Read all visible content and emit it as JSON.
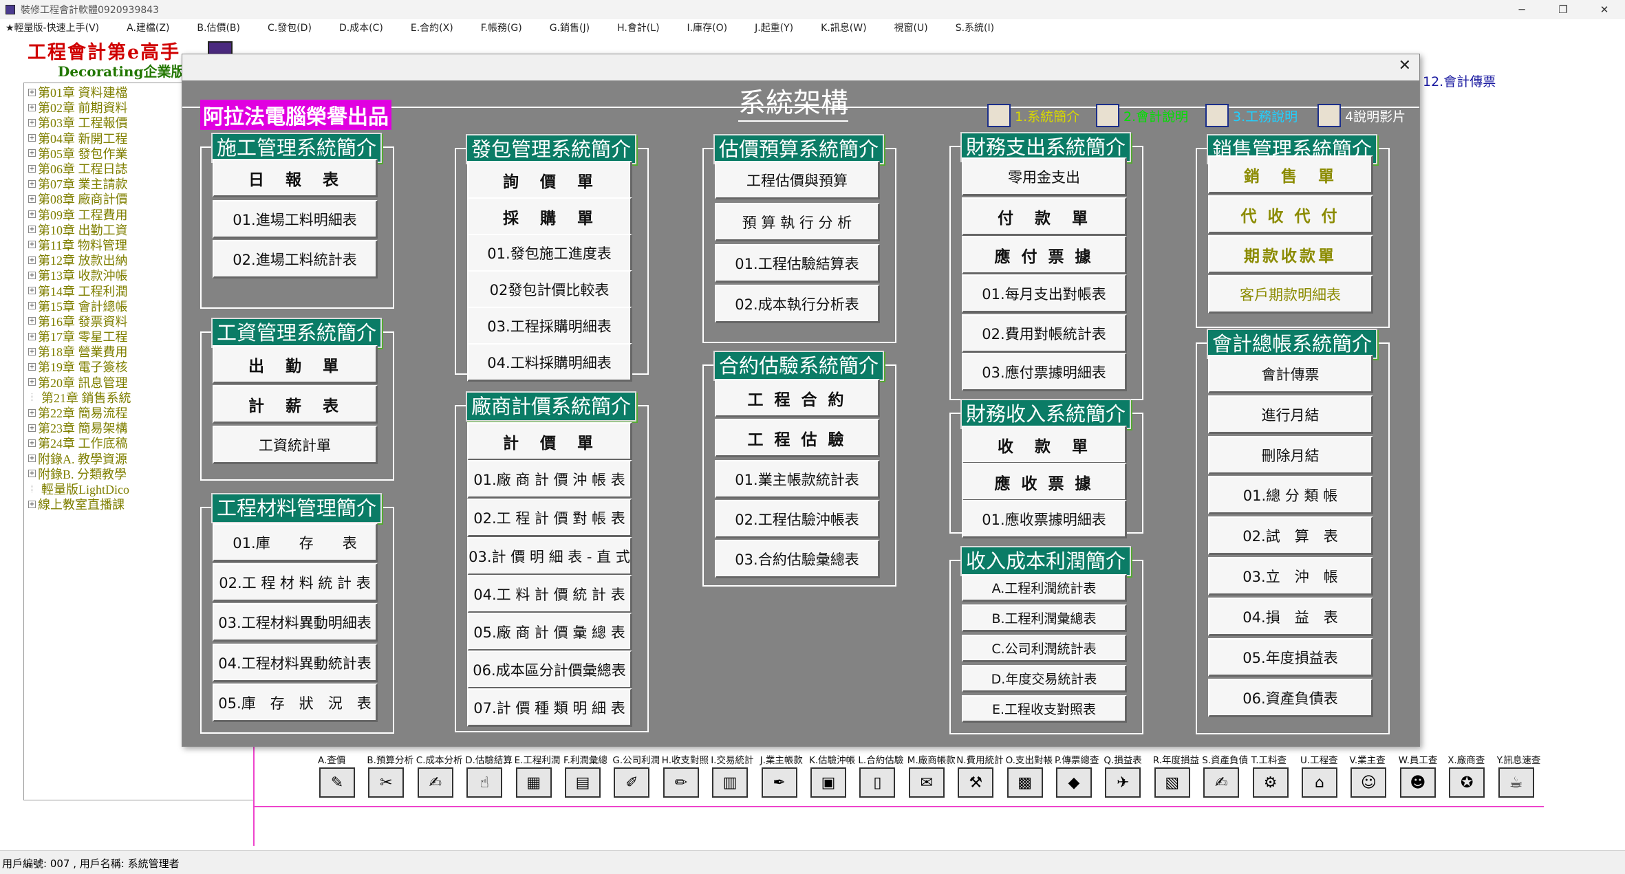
{
  "window": {
    "title": "裝修工程會計軟體0920939843"
  },
  "menubar": [
    "★輕量版-快速上手(V)",
    "A.建檔(Z)",
    "B.估價(B)",
    "C.發包(D)",
    "D.成本(C)",
    "E.合約(X)",
    "F.帳務(G)",
    "G.銷售(J)",
    "H.會計(L)",
    "I.庫存(O)",
    "J.起重(Y)",
    "K.訊息(W)",
    "視窗(U)",
    "S.系統(I)"
  ],
  "brand": {
    "title": "工程會計第e高手",
    "subtitle": "Decorating企業版"
  },
  "tree": [
    {
      "toggle": "+",
      "label": "第01章 資料建檔"
    },
    {
      "toggle": "+",
      "label": "第02章 前期資料"
    },
    {
      "toggle": "+",
      "label": "第03章 工程報價"
    },
    {
      "toggle": "+",
      "label": "第04章 新開工程"
    },
    {
      "toggle": "+",
      "label": "第05章 發包作業"
    },
    {
      "toggle": "+",
      "label": "第06章 工程日誌"
    },
    {
      "toggle": "+",
      "label": "第07章 業主請款"
    },
    {
      "toggle": "+",
      "label": "第08章 廠商計價"
    },
    {
      "toggle": "+",
      "label": "第09章 工程費用"
    },
    {
      "toggle": "+",
      "label": "第10章 出勤工資"
    },
    {
      "toggle": "+",
      "label": "第11章 物料管理"
    },
    {
      "toggle": "+",
      "label": "第12章 放款出納"
    },
    {
      "toggle": "+",
      "label": "第13章 收款沖帳"
    },
    {
      "toggle": "+",
      "label": "第14章 工程利潤"
    },
    {
      "toggle": "+",
      "label": "第15章 會計總帳"
    },
    {
      "toggle": "+",
      "label": "第16章 發票資料"
    },
    {
      "toggle": "+",
      "label": "第17章 零星工程"
    },
    {
      "toggle": "+",
      "label": "第18章 營業費用"
    },
    {
      "toggle": "+",
      "label": "第19章 電子簽核"
    },
    {
      "toggle": "+",
      "label": "第20章 訊息管理"
    },
    {
      "toggle": "",
      "label": "第21章 銷售系統"
    },
    {
      "toggle": "+",
      "label": "第22章 簡易流程"
    },
    {
      "toggle": "+",
      "label": "第23章 簡易架構"
    },
    {
      "toggle": "+",
      "label": "第24章 工作底稿"
    },
    {
      "toggle": "+",
      "label": "附錄A. 教學資源"
    },
    {
      "toggle": "+",
      "label": "附錄B. 分類教學"
    },
    {
      "toggle": "",
      "label": "輕量版LightDico"
    },
    {
      "toggle": "+",
      "label": "線上教室直播課"
    }
  ],
  "side_link": "12.會計傳票",
  "dialog": {
    "title": "系統架構",
    "publisher": "阿拉法電腦榮譽出品",
    "header_links": [
      {
        "label": "1.系統簡介",
        "color": "#d8d800",
        "icon": "book-icon"
      },
      {
        "label": "2.會計說明",
        "color": "#00e000",
        "icon": "pencil-hand-icon"
      },
      {
        "label": "3.工務說明",
        "color": "#20d0ff",
        "icon": "pencil-hand-icon"
      },
      {
        "label": "4說明影片",
        "color": "#ffffff",
        "icon": "video-cube-icon"
      }
    ],
    "groups": {
      "construction": {
        "title": "施工管理系統簡介",
        "buttons": [
          "日　報　表",
          "01.進場工料明細表",
          "02.進場工料統計表"
        ]
      },
      "payroll": {
        "title": "工資管理系統簡介",
        "buttons": [
          "出　勤　單",
          "計　薪　表",
          "工資統計單"
        ]
      },
      "material": {
        "title": "工程材料管理簡介",
        "buttons": [
          "01.庫　　存　　表",
          "02.工 程 材 料 統 計 表",
          "03.工程材料異動明細表",
          "04.工程材料異動統計表",
          "05.庫　存　狀　況　表"
        ]
      },
      "subcontract": {
        "title": "發包管理系統簡介",
        "buttons": [
          "詢　價　單",
          "採　購　單",
          "01.發包施工進度表",
          "02發包計價比較表",
          "03.工程採購明細表",
          "04.工料採購明細表"
        ]
      },
      "vendor": {
        "title": "廠商計價系統簡介",
        "buttons": [
          "計　價　單",
          "01.廠 商 計 價 沖 帳 表",
          "02.工 程 計 價 對 帳 表",
          "03.計 價 明 細 表 - 直 式",
          "04.工 料 計 價 統 計 表",
          "05.廠 商 計 價 彙 總 表",
          "06.成本區分計價彙總表",
          "07.計 價 種 類 明 細 表"
        ]
      },
      "estimate": {
        "title": "估價預算系統簡介",
        "buttons": [
          "工程估價與預算",
          "預 算 執 行 分 析",
          "01.工程估驗結算表",
          "02.成本執行分析表"
        ]
      },
      "contract": {
        "title": "合約估驗系統簡介",
        "buttons": [
          "工 程 合 約",
          "工 程 估 驗",
          "01.業主帳款統計表",
          "02.工程估驗沖帳表",
          "03.合約估驗彙總表"
        ]
      },
      "expense": {
        "title": "財務支出系統簡介",
        "buttons": [
          "零用金支出",
          "付　款　單",
          "應 付 票 據",
          "01.每月支出對帳表",
          "02.費用對帳統計表",
          "03.應付票據明細表"
        ]
      },
      "income": {
        "title": "財務收入系統簡介",
        "buttons": [
          "收　款　單",
          "應 收 票 據",
          "01.應收票據明細表"
        ]
      },
      "profit": {
        "title": "收入成本利潤簡介",
        "buttons": [
          "A.工程利潤統計表",
          "B.工程利潤彙總表",
          "C.公司利潤統計表",
          "D.年度交易統計表",
          "E.工程收支對照表"
        ]
      },
      "sales": {
        "title": "銷售管理系統簡介",
        "buttons": [
          "銷　售　單",
          "代 收 代 付",
          "期款收款單",
          "客戶期款明細表"
        ]
      },
      "ledger": {
        "title": "會計總帳系統簡介",
        "buttons": [
          "會計傳票",
          "進行月結",
          "刪除月結",
          "01.總 分 類 帳",
          "02.試　算　表",
          "03.立　沖　帳",
          "04.損　益　表",
          "05.年度損益表",
          "06.資產負債表"
        ]
      }
    }
  },
  "toolbar": [
    {
      "label": "A.查價",
      "icon": "price-check-icon",
      "glyph": "✎"
    },
    {
      "label": "B.預算分析",
      "icon": "budget-analysis-icon",
      "glyph": "✂"
    },
    {
      "label": "C.成本分析",
      "icon": "cost-analysis-icon",
      "glyph": "✍"
    },
    {
      "label": "D.估驗結算",
      "icon": "settlement-icon",
      "glyph": "☝"
    },
    {
      "label": "E.工程利潤",
      "icon": "project-profit-icon",
      "glyph": "▦"
    },
    {
      "label": "F.利潤彙總",
      "icon": "profit-summary-icon",
      "glyph": "▤"
    },
    {
      "label": "G.公司利潤",
      "icon": "company-profit-icon",
      "glyph": "✐"
    },
    {
      "label": "H.收支對照",
      "icon": "income-expense-icon",
      "glyph": "✏"
    },
    {
      "label": "I.交易統計",
      "icon": "trade-stats-icon",
      "glyph": "▥"
    },
    {
      "label": "J.業主帳款",
      "icon": "owner-account-icon",
      "glyph": "✒"
    },
    {
      "label": "K.估驗沖帳",
      "icon": "offset-icon",
      "glyph": "▣"
    },
    {
      "label": "L.合約估驗",
      "icon": "contract-book-icon",
      "glyph": "▯"
    },
    {
      "label": "M.廠商帳款",
      "icon": "vendor-account-icon",
      "glyph": "✉"
    },
    {
      "label": "N.費用統計",
      "icon": "expense-stats-icon",
      "glyph": "⚒"
    },
    {
      "label": "O.支出對帳",
      "icon": "payment-reconcile-icon",
      "glyph": "▩"
    },
    {
      "label": "P.傳票總查",
      "icon": "voucher-cube-icon",
      "glyph": "◆"
    },
    {
      "label": "Q.損益表",
      "icon": "income-statement-icon",
      "glyph": "✈"
    },
    {
      "label": "R.年度損益",
      "icon": "annual-profit-icon",
      "glyph": "▧"
    },
    {
      "label": "S.資產負債",
      "icon": "balance-sheet-icon",
      "glyph": "✍"
    },
    {
      "label": "T.工料查",
      "icon": "material-query-icon",
      "glyph": "⚙"
    },
    {
      "label": "U.工程查",
      "icon": "project-house-icon",
      "glyph": "⌂"
    },
    {
      "label": "V.業主查",
      "icon": "owner-query-icon",
      "glyph": "☺"
    },
    {
      "label": "W.員工查",
      "icon": "employee-query-icon",
      "glyph": "☻"
    },
    {
      "label": "X.廠商查",
      "icon": "vendor-query-icon",
      "glyph": "✪"
    },
    {
      "label": "Y.訊息速查",
      "icon": "message-coffee-icon",
      "glyph": "☕"
    }
  ],
  "status": {
    "text": "用戶編號: 007 , 用戶名稱: 系統管理者"
  },
  "colors": {
    "canvas": "#838383",
    "group_header": "#0b7c66",
    "publisher_bg": "#e000e0",
    "tree_text": "#7f7f00",
    "brand": "#d00000"
  }
}
